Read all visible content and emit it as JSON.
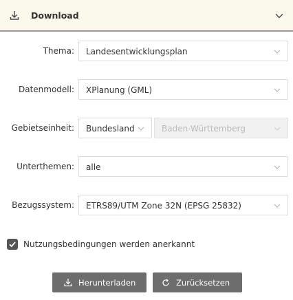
{
  "header": {
    "title": "Download",
    "icons": {
      "download": "download-icon",
      "collapse": "chevron-down-icon"
    }
  },
  "form": {
    "thema": {
      "label": "Thema:",
      "value": "Landesentwicklungsplan"
    },
    "datenmodell": {
      "label": "Datenmodell:",
      "value": "XPlanung (GML)"
    },
    "gebietseinheit": {
      "label": "Gebietseinheit:",
      "value": "Bundesland",
      "sub_value": "Baden-Württemberg",
      "sub_disabled": true
    },
    "unterthemen": {
      "label": "Unterthemen:",
      "value": "alle"
    },
    "bezugssystem": {
      "label": "Bezugssystem:",
      "value": "ETRS89/UTM Zone 32N (EPSG 25832)"
    }
  },
  "consent": {
    "label": "Nutzungsbedingungen werden anerkannt",
    "checked": true
  },
  "buttons": {
    "download_label": "Herunterladen",
    "reset_label": "Zurücksetzen"
  },
  "colors": {
    "header_bg": "#fbf8ec",
    "button_bg": "#6d6d6d",
    "checkbox_bg": "#555555"
  }
}
